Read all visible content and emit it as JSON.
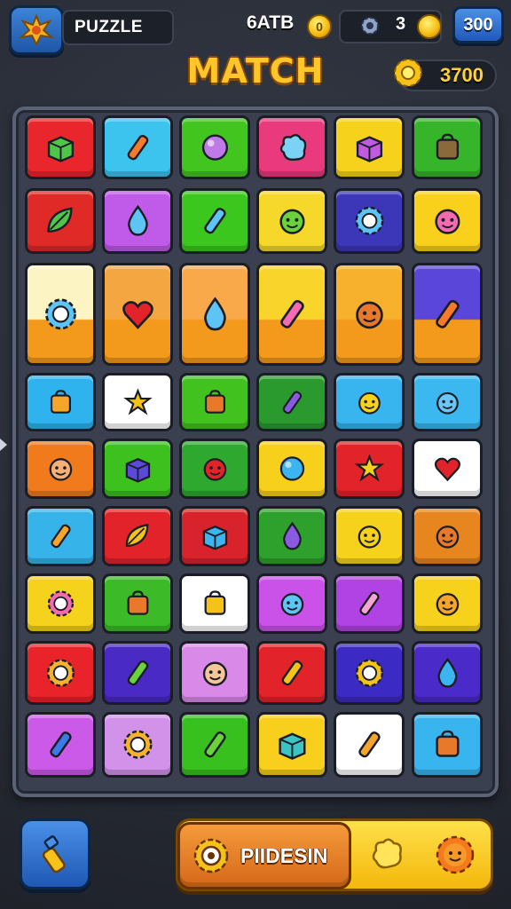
{
  "header": {
    "title": "PUZZLE",
    "moves_label": "6ATB",
    "moves_coin": "0",
    "plate_value": "3",
    "button_value": "300",
    "game_title": "MATCH",
    "score": "3700"
  },
  "board": {
    "rows": 9,
    "cols": 6,
    "tiles": [
      {
        "color": "#e8262c",
        "icon": "green-cube-icon"
      },
      {
        "color": "#3cc4ef",
        "icon": "orange-rocket-icon"
      },
      {
        "color": "#43c51f",
        "icon": "magnifier-icon"
      },
      {
        "color": "#e83a7c",
        "icon": "blue-blob-icon"
      },
      {
        "color": "#f7d21c",
        "icon": "purple-box-icon"
      },
      {
        "color": "#36b52a",
        "icon": "radio-icon"
      },
      {
        "color": "#e02a28",
        "icon": "leaf-icon"
      },
      {
        "color": "#c05ae8",
        "icon": "blue-drop-icon"
      },
      {
        "color": "#3cc71f",
        "icon": "key-icon"
      },
      {
        "color": "#f5d82a",
        "icon": "green-monster-icon"
      },
      {
        "color": "#3c36b8",
        "icon": "sun-robot-icon"
      },
      {
        "color": "#f9d01c",
        "icon": "pink-blob-icon"
      },
      {
        "color": "#fcf4c2",
        "icon": "blue-virus-icon",
        "tall": true
      },
      {
        "color": "#f4a640",
        "icon": "red-heart-icon",
        "tall": true
      },
      {
        "color": "#f9a84a",
        "icon": "blue-drop-icon",
        "tall": true
      },
      {
        "color": "#f9d42a",
        "icon": "pink-key-icon",
        "tall": true
      },
      {
        "color": "#f7b12c",
        "icon": "orange-cat-icon",
        "tall": true
      },
      {
        "color": "#5a46d8",
        "icon": "bottle-icon",
        "tall": true
      },
      {
        "color": "#2fb3ef",
        "icon": "bag-icon"
      },
      {
        "color": "#ffffff",
        "icon": "star-icon"
      },
      {
        "color": "#42c21f",
        "icon": "cookie-icon"
      },
      {
        "color": "#2a9a2f",
        "icon": "pencil-icon"
      },
      {
        "color": "#38b4ef",
        "icon": "yellow-face-icon"
      },
      {
        "color": "#3ab8ef",
        "icon": "blue-cat-icon"
      },
      {
        "color": "#f07a1c",
        "icon": "smile-face-icon"
      },
      {
        "color": "#3cc11e",
        "icon": "purple-shape-icon"
      },
      {
        "color": "#2ea82f",
        "icon": "red-cat-icon"
      },
      {
        "color": "#f7d01c",
        "icon": "blue-ball-icon"
      },
      {
        "color": "#e2232a",
        "icon": "yellow-star-icon"
      },
      {
        "color": "#ffffff",
        "icon": "heart-icon"
      },
      {
        "color": "#36b4ea",
        "icon": "crayon-icon"
      },
      {
        "color": "#e2232a",
        "icon": "yellow-leaf-icon"
      },
      {
        "color": "#d8232c",
        "icon": "blue-cube-icon"
      },
      {
        "color": "#2ea02c",
        "icon": "balloon-icon"
      },
      {
        "color": "#f7d21c",
        "icon": "cat-face-icon"
      },
      {
        "color": "#e7851e",
        "icon": "orange-cat-icon"
      },
      {
        "color": "#f5d21c",
        "icon": "pink-virus-icon"
      },
      {
        "color": "#3cba28",
        "icon": "jar-icon"
      },
      {
        "color": "#ffffff",
        "icon": "yellow-bag-icon"
      },
      {
        "color": "#cb52e8",
        "icon": "blue-monster-icon"
      },
      {
        "color": "#b142e3",
        "icon": "flashlight-icon"
      },
      {
        "color": "#f7d21c",
        "icon": "bear-icon"
      },
      {
        "color": "#e8232a",
        "icon": "sun-face-icon"
      },
      {
        "color": "#4a2ac4",
        "icon": "green-rocket-icon"
      },
      {
        "color": "#d98ae8",
        "icon": "bear-face-icon"
      },
      {
        "color": "#e2232a",
        "icon": "yellow-key-icon"
      },
      {
        "color": "#3c2ac4",
        "icon": "sun-icon"
      },
      {
        "color": "#4a2ac8",
        "icon": "blue-swirl-icon"
      },
      {
        "color": "#cb5ae8",
        "icon": "blue-crayon-icon"
      },
      {
        "color": "#d292ea",
        "icon": "sun-face-icon"
      },
      {
        "color": "#38c11e",
        "icon": "green-pipe-icon"
      },
      {
        "color": "#f7cf1c",
        "icon": "teal-cube-icon"
      },
      {
        "color": "#ffffff",
        "icon": "spoon-icon"
      },
      {
        "color": "#38b4ef",
        "icon": "house-icon"
      }
    ]
  },
  "footer": {
    "action_label": "PIIDESIN"
  },
  "colors": {
    "accent": "#ffc62b",
    "frame": "#3a4050"
  }
}
